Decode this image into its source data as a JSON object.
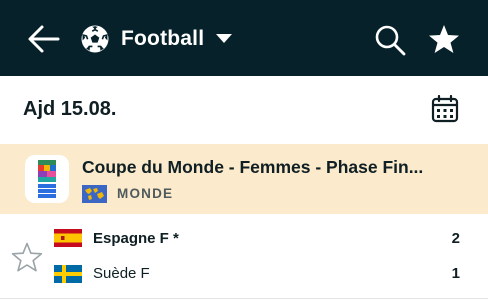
{
  "header": {
    "sport": "Football",
    "icons": [
      "arrow-left-icon",
      "soccer-ball-icon",
      "caret-down-icon",
      "search-icon",
      "star-icon"
    ],
    "colors": {
      "bar_bg": "#06212a",
      "text": "#ffffff"
    }
  },
  "date_bar": {
    "label": "Ajd 15.08.",
    "icon": "calendar-icon"
  },
  "league": {
    "name": "Coupe du Monde - Femmes - Phase Fin...",
    "country": "MONDE",
    "colors": {
      "bg": "#fbeacb",
      "country_text": "#4f5a5e"
    }
  },
  "match": {
    "home": {
      "name": "Espagne F *",
      "score": "2",
      "flag": "spain-flag"
    },
    "away": {
      "name": "Suède F",
      "score": "1",
      "flag": "sweden-flag"
    },
    "favorite_icon": "star-outline-icon"
  }
}
